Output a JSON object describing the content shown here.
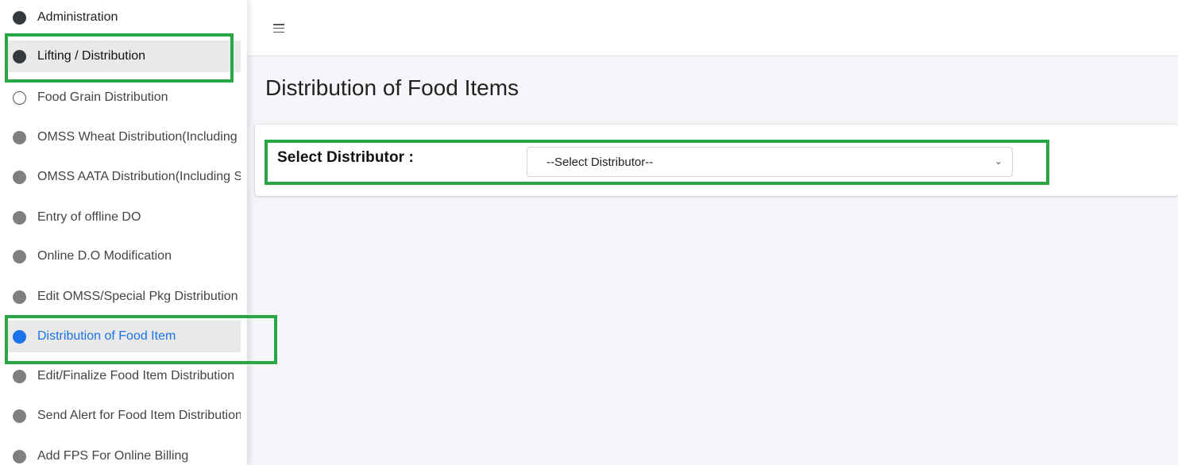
{
  "sidebar": {
    "items": [
      {
        "label": "Administration"
      },
      {
        "label": "Lifting / Distribution"
      },
      {
        "label": "Food Grain Distribution"
      },
      {
        "label": "OMSS Wheat Distribution(Including Special Pkg)"
      },
      {
        "label": "OMSS AATA Distribution(Including Special Pkg)"
      },
      {
        "label": "Entry of offline DO"
      },
      {
        "label": "Online D.O Modification"
      },
      {
        "label": "Edit OMSS/Special Pkg Distribution"
      },
      {
        "label": "Distribution of Food Item"
      },
      {
        "label": "Edit/Finalize Food Item Distribution"
      },
      {
        "label": "Send Alert for Food Item Distribution"
      },
      {
        "label": "Add FPS For Online Billing"
      }
    ]
  },
  "topbar": {
    "menu_icon": "hamburger-icon"
  },
  "main": {
    "title": "Distribution of Food Items",
    "form": {
      "distributor_label": "Select Distributor :",
      "distributor_selected": "--Select Distributor--"
    }
  },
  "colors": {
    "accent": "#1a73e8",
    "highlight": "#28a745"
  }
}
